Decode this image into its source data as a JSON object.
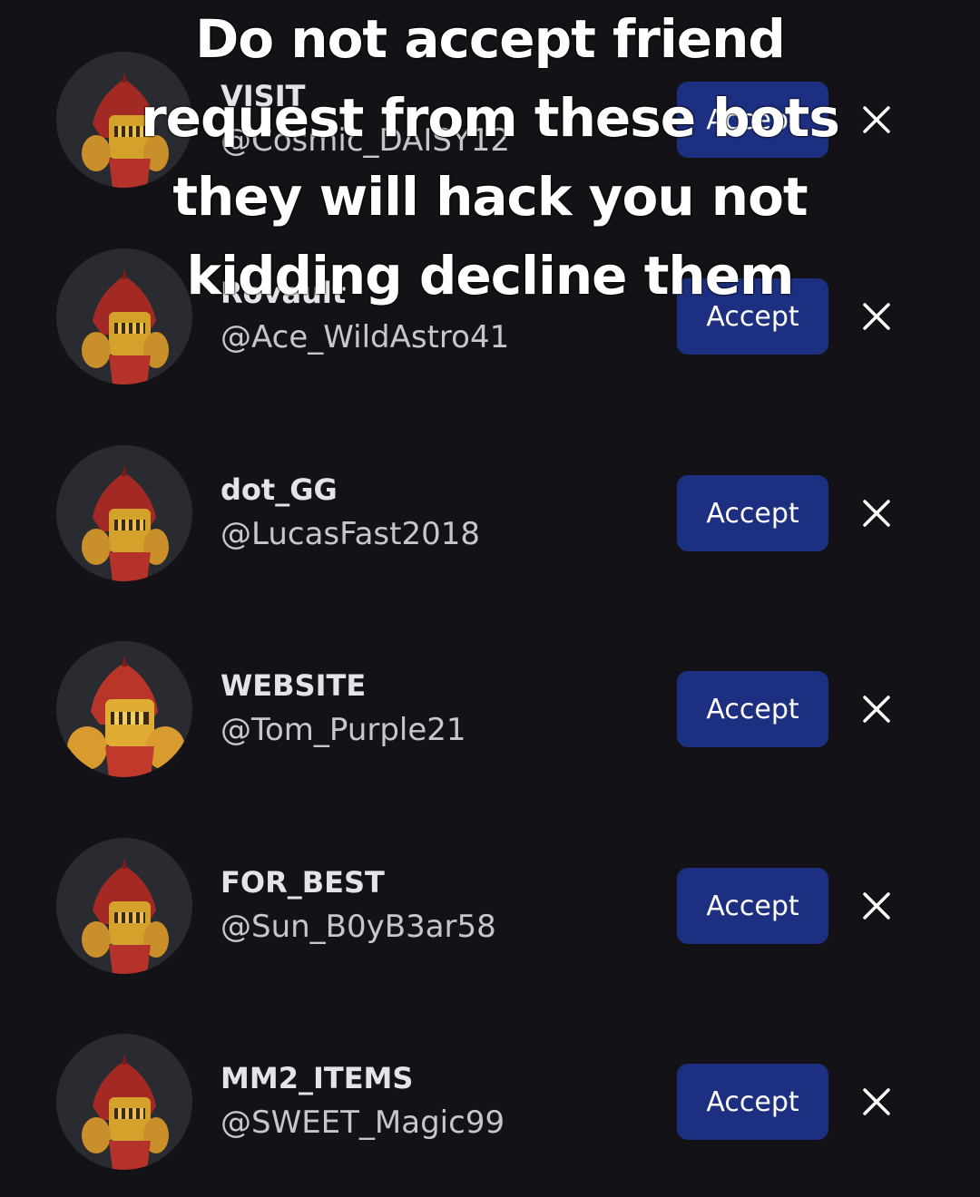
{
  "caption": {
    "lines": [
      "Do not accept friend",
      "request from these bots",
      "they will hack you not",
      "kidding decline them"
    ]
  },
  "requests": [
    {
      "display_name": "VISIT",
      "username": "@Cosmic_DAISY12",
      "accept_label": "Accept",
      "avatar_icon": "knight-avatar-icon"
    },
    {
      "display_name": "Rovault",
      "username": "@Ace_WildAstro41",
      "accept_label": "Accept",
      "avatar_icon": "knight-avatar-icon"
    },
    {
      "display_name": "dot_GG",
      "username": "@LucasFast2018",
      "accept_label": "Accept",
      "avatar_icon": "knight-avatar-icon"
    },
    {
      "display_name": "WEBSITE",
      "username": "@Tom_Purple21",
      "accept_label": "Accept",
      "avatar_icon": "knight-avatar-icon"
    },
    {
      "display_name": "FOR_BEST",
      "username": "@Sun_B0yB3ar58",
      "accept_label": "Accept",
      "avatar_icon": "knight-avatar-icon"
    },
    {
      "display_name": "MM2_ITEMS",
      "username": "@SWEET_Magic99",
      "accept_label": "Accept",
      "avatar_icon": "knight-avatar-icon"
    }
  ],
  "colors": {
    "background": "#121217",
    "accept_button": "#1d2f80",
    "avatar_background": "#2a2b30"
  }
}
